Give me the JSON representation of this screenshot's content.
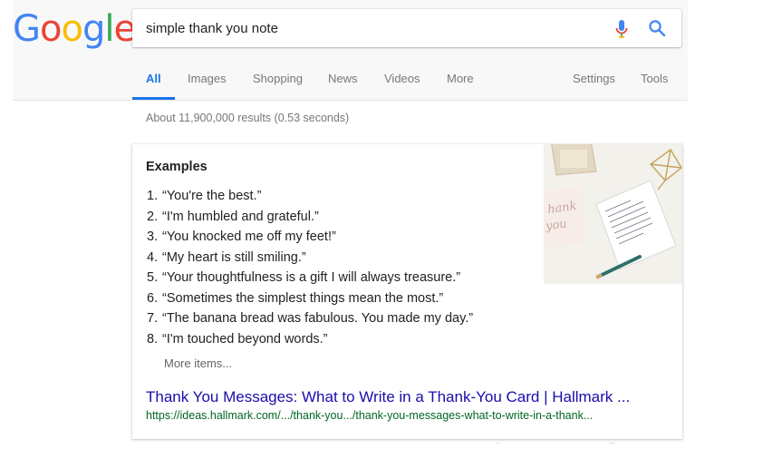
{
  "logo": {
    "text": "Google",
    "letters": [
      {
        "ch": "G",
        "color": "#4285F4"
      },
      {
        "ch": "o",
        "color": "#EA4335"
      },
      {
        "ch": "o",
        "color": "#FBBC05"
      },
      {
        "ch": "g",
        "color": "#4285F4"
      },
      {
        "ch": "l",
        "color": "#34A853"
      },
      {
        "ch": "e",
        "color": "#EA4335"
      }
    ]
  },
  "search": {
    "value": "simple thank you note",
    "mic_icon": "mic-icon",
    "search_icon": "search-icon"
  },
  "tabs": {
    "all": "All",
    "images": "Images",
    "shopping": "Shopping",
    "news": "News",
    "videos": "Videos",
    "more": "More",
    "settings": "Settings",
    "tools": "Tools",
    "active": "All"
  },
  "stats": "About 11,900,000 results (0.53 seconds)",
  "snippet": {
    "title": "Examples",
    "items": [
      {
        "num": "1.",
        "text": "“You're the best.”"
      },
      {
        "num": "2.",
        "text": "“I'm humbled and grateful.”"
      },
      {
        "num": "3.",
        "text": "“You knocked me off my feet!”"
      },
      {
        "num": "4.",
        "text": "“My heart is still smiling.”"
      },
      {
        "num": "5.",
        "text": "“Your thoughtfulness is a gift I will always treasure.”"
      },
      {
        "num": "6.",
        "text": "“Sometimes the simplest things mean the most.”"
      },
      {
        "num": "7.",
        "text": "“The banana bread was fabulous. You made my day.”"
      },
      {
        "num": "8.",
        "text": "“I'm touched beyond words.”"
      }
    ],
    "more_items": "More items...",
    "result_title": "Thank You Messages: What to Write in a Thank-You Card | Hallmark ...",
    "result_url": "https://ideas.hallmark.com/.../thank-you.../thank-you-messages-what-to-write-in-a-thank...",
    "image_icon": "thank-you-card-image"
  },
  "colors": {
    "accent": "#1a73e8",
    "link": "#1a0dab",
    "url": "#006621",
    "muted": "#777777"
  }
}
